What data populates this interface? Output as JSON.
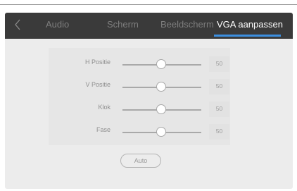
{
  "tabs": {
    "audio": "Audio",
    "scherm": "Scherm",
    "beeldscherm": "Beeldscherm",
    "vga": "VGA aanpassen"
  },
  "active_tab": "VGA aanpassen",
  "sliders": [
    {
      "label": "H Positie",
      "value": "50",
      "level": 50
    },
    {
      "label": "V Positie",
      "value": "50",
      "level": 50
    },
    {
      "label": "Klok",
      "value": "50",
      "level": 50
    },
    {
      "label": "Fase",
      "value": "50",
      "level": 50
    }
  ],
  "auto_button": "Auto",
  "colors": {
    "tabbar_bg": "#3a3a3a",
    "active_underline": "#3c8fe0",
    "screen_bg": "#ececec"
  },
  "icons": {
    "back": "chevron-left-icon"
  }
}
